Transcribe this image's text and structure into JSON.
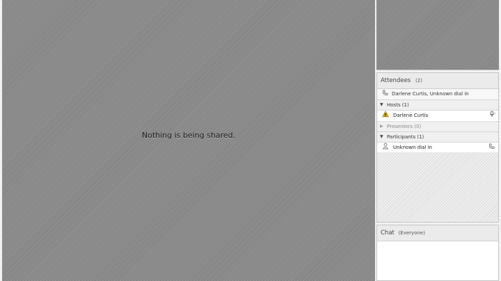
{
  "share": {
    "message": "Nothing is being shared."
  },
  "attendees": {
    "title": "Attendees",
    "count": "(2)",
    "summary": "Darlene Curtis, Unknown dial in",
    "groups": [
      {
        "label": "Hosts (1)",
        "expanded": true,
        "members": [
          {
            "name": "Darlene Curtis",
            "role_icon": "host-icon",
            "status_icon": "microphone-icon"
          }
        ]
      },
      {
        "label": "Presenters (0)",
        "expanded": false,
        "members": []
      },
      {
        "label": "Participants (1)",
        "expanded": true,
        "members": [
          {
            "name": "Unknown dial in",
            "role_icon": "participant-icon",
            "status_icon": "phone-icon"
          }
        ]
      }
    ]
  },
  "chat": {
    "title": "Chat",
    "scope": "(Everyone)"
  },
  "colors": {
    "stage": "#8a8a8a",
    "panel_header": "#ebebeb",
    "host_badge": "#e0b020"
  }
}
